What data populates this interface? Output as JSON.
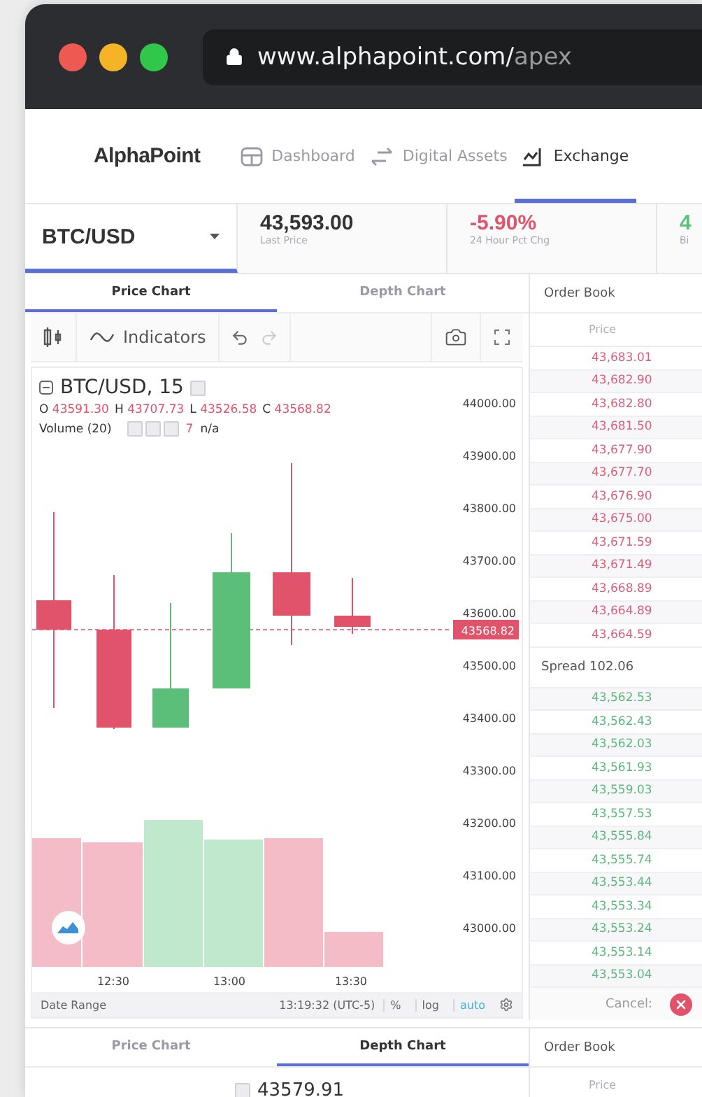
{
  "browser": {
    "url_host": "www.alphapoint.com/",
    "url_path": "apex"
  },
  "nav": {
    "brand": "AlphaPoint",
    "items": [
      {
        "label": "Dashboard",
        "kind": "dashboard",
        "selected": false
      },
      {
        "label": "Digital Assets",
        "kind": "transfer",
        "selected": false
      },
      {
        "label": "Exchange",
        "kind": "exchange",
        "selected": true
      }
    ]
  },
  "ticker": {
    "pair": "BTC/USD",
    "stats": [
      {
        "value": "43,593.00",
        "label": "Last Price",
        "color": "#333333"
      },
      {
        "value": "-5.90%",
        "label": "24 Hour Pct Chg",
        "color": "#e0536b"
      },
      {
        "value": "4",
        "label": "Bi",
        "color": "#5bbf7a"
      }
    ]
  },
  "chart_panel": {
    "tabs": [
      {
        "label": "Price Chart",
        "selected": true
      },
      {
        "label": "Depth Chart",
        "selected": false
      }
    ],
    "indicators": "Indicators",
    "legend": {
      "title": "BTC/USD, 15",
      "ohlc": [
        {
          "key": "O",
          "value": "43591.30"
        },
        {
          "key": "H",
          "value": "43707.73"
        },
        {
          "key": "L",
          "value": "43526.58"
        },
        {
          "key": "C",
          "value": "43568.82"
        }
      ],
      "volume_label": "Volume (20)",
      "volume_value": "7",
      "volume_extra": "n/a"
    },
    "price_axis": [
      "44000.00",
      "43900.00",
      "43800.00",
      "43700.00",
      "43600.00",
      "43500.00",
      "43400.00",
      "43300.00",
      "43200.00",
      "43100.00",
      "43000.00"
    ],
    "current_price": "43568.82",
    "time_axis": [
      "12:30",
      "13:00",
      "13:30"
    ],
    "footer": {
      "date_range": "Date Range",
      "time": "13:19:32 (UTC-5)",
      "options": [
        {
          "label": "%",
          "selected": false
        },
        {
          "label": "log",
          "selected": false
        },
        {
          "label": "auto",
          "selected": true
        }
      ]
    }
  },
  "order_book": {
    "title": "Order Book",
    "column": "Price",
    "asks": [
      "43,683.01",
      "43,682.90",
      "43,682.80",
      "43,681.50",
      "43,677.90",
      "43,677.70",
      "43,676.90",
      "43,675.00",
      "43,671.59",
      "43,671.49",
      "43,668.89",
      "43,664.89",
      "43,664.59"
    ],
    "spread": "Spread 102.06",
    "bids": [
      "43,562.53",
      "43,562.43",
      "43,562.03",
      "43,561.93",
      "43,559.03",
      "43,557.53",
      "43,555.84",
      "43,555.74",
      "43,553.44",
      "43,553.34",
      "43,553.24",
      "43,553.14",
      "43,553.04"
    ],
    "cancel_label": "Cancel:"
  },
  "lower_panel": {
    "tabs": [
      {
        "label": "Price Chart",
        "selected": false
      },
      {
        "label": "Depth Chart",
        "selected": true
      }
    ],
    "legend_value": "43579.91",
    "order_book_title": "Order Book",
    "column": "Price"
  }
}
